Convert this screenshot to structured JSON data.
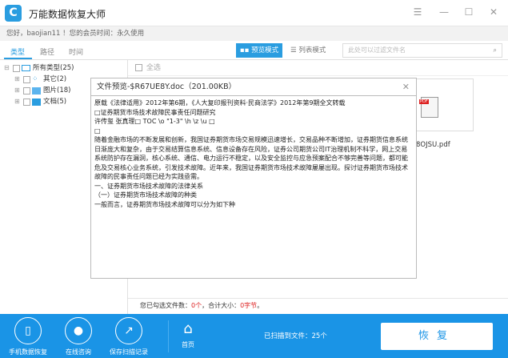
{
  "app": {
    "title": "万能数据恢复大师",
    "greeting": "您好，baojian11 ！您的会员时间：永久使用"
  },
  "tabs": [
    "类型",
    "路径",
    "时间"
  ],
  "toolbar": {
    "preview_mode": "预览模式",
    "list_mode": "列表模式",
    "search_placeholder": "此处可以过滤文件名"
  },
  "tree": [
    {
      "label": "所有类型(25)",
      "icon": "computer-icon"
    },
    {
      "label": "其它(2)",
      "icon": "grid-icon"
    },
    {
      "label": "图片(18)",
      "icon": "image-icon"
    },
    {
      "label": "文档(5)",
      "icon": "folder-icon"
    }
  ],
  "select_all": "全选",
  "file": {
    "name": "8OJSU.pdf",
    "tag": "PDF"
  },
  "preview": {
    "title": "文件预览-$R67UE8Y.doc（201.00KB）",
    "lines": [
      "原载《法律适用》2012年第6期，《人大复印报刊资料·民商法学》2012年第9期全文转载",
      "□证券期货市场技术故障民事责任问题研究",
      "许传玺 张真理□ TOC \\o \"1-3\" \\h \\z \\u □",
      "□",
      "随着金融市场的不断发展和创新，我国证券期货市场交易规模迅速增长，交易品种不断增加，证券期货信息系统日渐庞大和复杂，由于交易结算信息系统、信息设备存在风险，证券公司期货公司IT治理机制不科学，网上交易系统防护存在漏洞，核心系统、通信、电力运行不稳定，以及安全监控与应急预案配合不够完善等问题，都可能危及交易核心业务系统，引发技术故障。近年来，我国证券期货市场技术故障屡屡出现。探讨证券期货市场技术故障的民事责任问题已经为实践亟需。",
      "一、证券期货市场技术故障的法律关系",
      "（一）证券期货市场技术故障的种类",
      "一般而言，证券期货市场技术故障可以分为如下种"
    ]
  },
  "status": {
    "prefix": "您已勾选文件数：",
    "count": "0个",
    "mid": "，合计大小：",
    "size": "0字节",
    "suffix": "。"
  },
  "footer": {
    "mobile": "手机数据恢复",
    "consult": "在线咨询",
    "save": "保存扫描记录",
    "home": "首页",
    "scanned": "已扫描到文件：25个",
    "recover": "恢复"
  },
  "colors": {
    "accent": "#1a94e6"
  }
}
